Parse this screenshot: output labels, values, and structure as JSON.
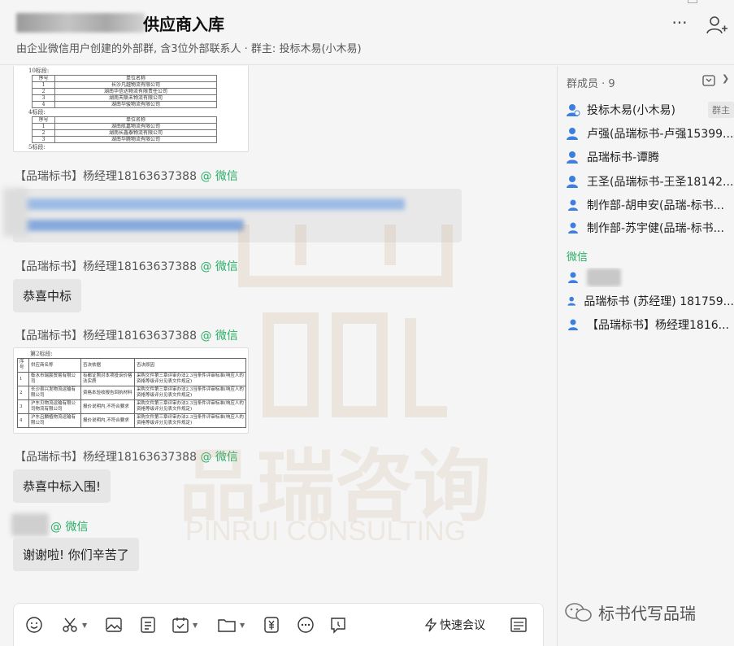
{
  "header": {
    "title": "供应商入库",
    "subtitle": "由企业微信用户创建的外部群, 含3位外部联系人 · 群主: 投标木易(小木易)",
    "more_label": "···"
  },
  "messages": {
    "sender_full": "【品瑞标书】杨经理18163637388",
    "via_wechat": "@ 微信",
    "bubble1": "恭喜中标",
    "bubble2": "恭喜中标入围!",
    "bubble3": "谢谢啦! 你们辛苦了"
  },
  "doc1": {
    "cap1": "10标段:",
    "col_no": "序号",
    "col_name": "单位名称",
    "rows_a": [
      "1",
      "2",
      "3",
      "4"
    ],
    "names_a": [
      "长沙凡越物流有限公司",
      "湖南华信达物流有限责任公司",
      "湖南天联未物流有限公司",
      "湖南华骏物流有限公司"
    ],
    "cap2": "4标段:",
    "rows_b": [
      "1",
      "2",
      "3"
    ],
    "names_b": [
      "湖南航嘉物流有限公司",
      "湖南长鑫泰物流有限公司",
      "湖南华腾物流有限公司"
    ],
    "cap3": "5标段:"
  },
  "doc2": {
    "cap": "第2标段:",
    "h1": "序号",
    "h2": "供应商名称",
    "h3": "否决依据",
    "h4": "否决原因",
    "rows": [
      {
        "no": "1",
        "name": "衡水市瑞宸贸易有限公司",
        "basis": "有都证照对本项投诉价格法实质",
        "reason": "采购文件第三章评审办法2.3当条件评审标准(响应人的资格等级评分见表文件规定)"
      },
      {
        "no": "2",
        "name": "长沙县兴发物流运输有限公司",
        "basis": "资格本验收报告回执材料",
        "reason": "采购文件第三章评审办法2.3当条件评审标准(响应人的资格等级评分见表文件规定)"
      },
      {
        "no": "3",
        "name": "沪东贝物流运输有限公司物流有限公司",
        "basis": "报价说明内,不符合要求",
        "reason": "采购文件第三章评审办法2.3当条件评审标准(响应人的资格等级评分见表文件规定)"
      },
      {
        "no": "4",
        "name": "沪东吕麟植物流运输有限公司",
        "basis": "报价说明内,不符合要求",
        "reason": "采购文件第三章评审办法2.3当条件评审标准(响应人的资格等级评分见表文件规定)"
      }
    ]
  },
  "watermark": {
    "cn": "品瑞咨询",
    "en": "PINRUI CONSULTING",
    "account": "标书代写品瑞"
  },
  "toolbar": {
    "quick_meeting": "快速会议"
  },
  "members": {
    "title": "群成员 · 9",
    "owner_badge": "群主",
    "list": [
      "投标木易(小木易)",
      "卢强(品瑞标书-卢强15399...",
      "品瑞标书-谭腾",
      "王圣(品瑞标书-王圣18142...",
      "制作部-胡申安(品瑞-标书...",
      "制作部-苏宇健(品瑞-标书..."
    ],
    "wechat_section": "微信",
    "wechat_list": [
      "品瑞标书 (苏经理) 181759...",
      "【品瑞标书】杨经理1816..."
    ]
  },
  "colors": {
    "wechat_green": "#2aae67",
    "corp_blue": "#3b7ddc",
    "member_icon_blue": "#3d7fe0",
    "bubble_gray": "#e6e6e6"
  },
  "icons": [
    "more-icon",
    "add-member-icon",
    "emoji-icon",
    "scissors-icon",
    "image-icon",
    "doc-icon",
    "todo-icon",
    "folder-icon",
    "money-icon",
    "more-circle-icon",
    "chat-record-icon",
    "bolt-icon",
    "history-icon",
    "collapse-icon",
    "member-icon",
    "wechat-logo-icon"
  ]
}
